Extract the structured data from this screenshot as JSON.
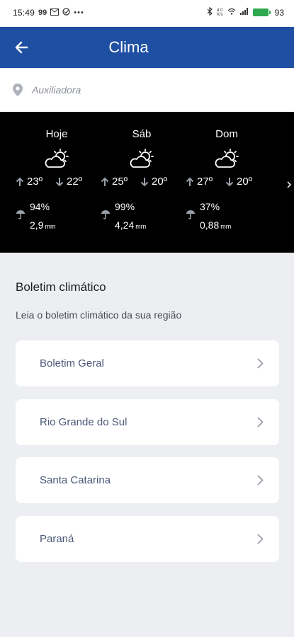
{
  "status_bar": {
    "time": "15:49",
    "indicators": [
      "99",
      "mail-icon",
      "sync-icon",
      "more-dots-icon"
    ],
    "right_icons": [
      "bluetooth-icon",
      "network-speed-icon",
      "wifi-icon",
      "signal-icon"
    ],
    "battery_pct": "93",
    "battery_color": "#2fa84f"
  },
  "header": {
    "title": "Clima",
    "back_icon": "arrow-left-icon",
    "bg_color": "#1e4fa2"
  },
  "location": {
    "icon": "location-pin-icon",
    "placeholder": "Auxiliadora"
  },
  "forecast": {
    "days": [
      {
        "name": "Hoje",
        "icon": "partly-cloudy-icon",
        "max": "23º",
        "min": "22º",
        "prob": "94%",
        "precip": "2,9",
        "unit": "mm"
      },
      {
        "name": "Sáb",
        "icon": "partly-cloudy-icon",
        "max": "25º",
        "min": "20º",
        "prob": "99%",
        "precip": "4,24",
        "unit": "mm"
      },
      {
        "name": "Dom",
        "icon": "partly-cloudy-icon",
        "max": "27º",
        "min": "20º",
        "prob": "37%",
        "precip": "0,88",
        "unit": "mm"
      }
    ]
  },
  "bulletin": {
    "title": "Boletim climático",
    "subtitle": "Leia o boletim climático da sua região",
    "items": [
      {
        "label": "Boletim Geral"
      },
      {
        "label": "Rio Grande do Sul"
      },
      {
        "label": "Santa Catarina"
      },
      {
        "label": "Paraná"
      }
    ]
  }
}
